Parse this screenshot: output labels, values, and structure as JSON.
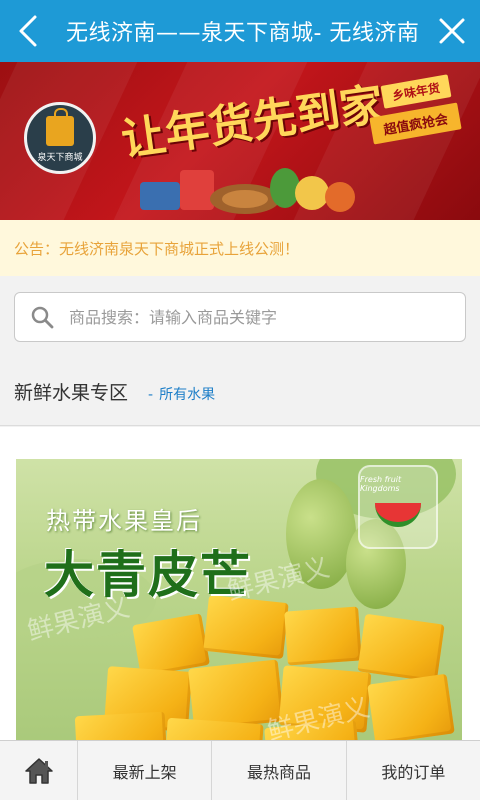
{
  "header": {
    "title": "无线济南——泉天下商城- 无线济南",
    "back_icon": "chevron-left-icon",
    "close_icon": "close-icon"
  },
  "banner": {
    "logo_text": "泉天下商城",
    "slogan": "让年货先到家",
    "ribbon_top": "乡味年货",
    "ribbon_bottom": "超值疯抢会"
  },
  "notice": {
    "text": "公告：无线济南泉天下商城正式上线公测！"
  },
  "search": {
    "placeholder": "商品搜索：请输入商品关键字",
    "value": ""
  },
  "section": {
    "title": "新鲜水果专区",
    "link_dash": "-",
    "link_label": "所有水果"
  },
  "product": {
    "subtitle": "热带水果皇后",
    "title": "大青皮芒",
    "brand_text": "Fresh fruit Kingdoms",
    "watermark": "鲜果演义"
  },
  "bottom_nav": {
    "home_icon": "home-icon",
    "items": [
      "最新上架",
      "最热商品",
      "我的订单"
    ]
  },
  "colors": {
    "header_bg": "#1e9ad6",
    "banner_red": "#c4161b",
    "notice_bg": "#fff8dc",
    "notice_text": "#e8a33a",
    "link_blue": "#1e7fc8"
  }
}
